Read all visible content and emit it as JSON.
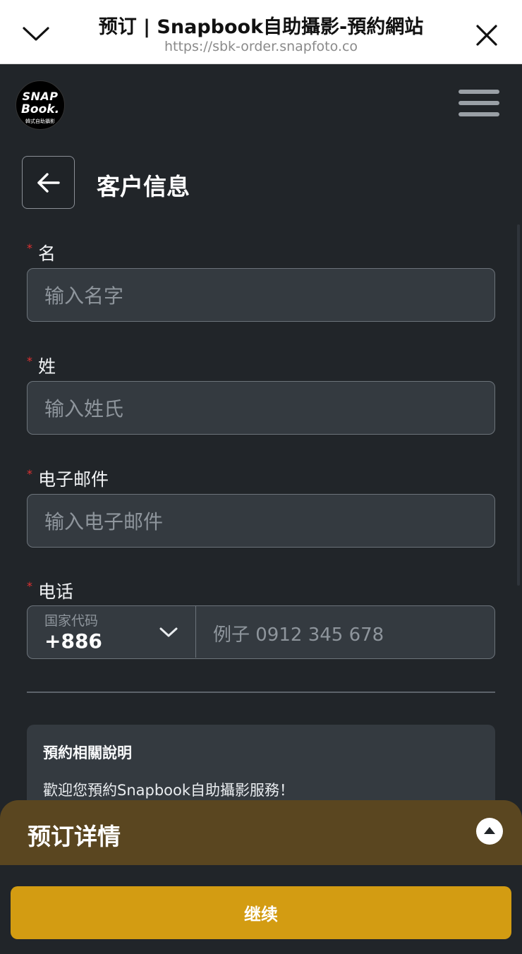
{
  "browser": {
    "title": "预订 | Snapbook自助攝影-預約網站",
    "url": "https://sbk-order.snapfoto.co"
  },
  "logo": {
    "line1": "SNAP",
    "line2": "Book.",
    "line3": "韓式自助攝影"
  },
  "page": {
    "title": "客户信息"
  },
  "form": {
    "required_mark": "*",
    "first_name": {
      "label": "名",
      "placeholder": "输入名字"
    },
    "last_name": {
      "label": "姓",
      "placeholder": "输入姓氏"
    },
    "email": {
      "label": "电子邮件",
      "placeholder": "输入电子邮件"
    },
    "phone": {
      "label": "电话",
      "country_caption": "国家代码",
      "country_value": "+886",
      "placeholder": "例子 0912 345 678"
    }
  },
  "notice": {
    "heading": "預約相關說明",
    "text": "歡迎您預約Snapbook自助攝影服務！"
  },
  "details": {
    "title": "预订详情"
  },
  "actions": {
    "continue_label": "继续"
  },
  "colors": {
    "background": "#212529",
    "input_bg": "#343a40",
    "required": "#e03131",
    "accent": "#d39c12",
    "drawer": "#5a4620"
  }
}
